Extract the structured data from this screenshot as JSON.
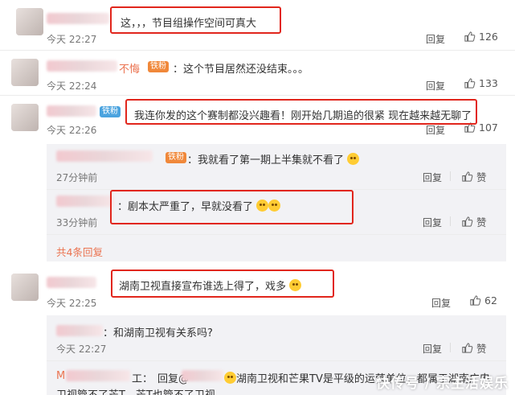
{
  "labels": {
    "reply": "回复",
    "zan": "赞"
  },
  "comments": [
    {
      "text": "这，，，节目组操作空间可真大",
      "time": "今天 22:27",
      "likes": "126"
    },
    {
      "name_suffix": "不悔",
      "badge": "铁粉",
      "text": "这个节目居然还没结束。。。",
      "time": "今天 22:24",
      "likes": "133"
    },
    {
      "badge": "铁粉",
      "text": "我连你发的这个赛制都没兴趣看！刚开始几期追的很紧 现在越来越无聊了",
      "time": "今天 22:26",
      "likes": "107"
    },
    {
      "text": "湖南卫视直接宣布谁选上得了，戏多",
      "time": "今天 22:25",
      "likes": "62"
    }
  ],
  "sub_replies_1": [
    {
      "badge": "铁粉",
      "text": "我就看了第一期上半集就不看了",
      "time": "27分钟前"
    },
    {
      "text": "剧本太严重了，早就没看了",
      "time": "33分钟前"
    }
  ],
  "more_replies": "共4条回复",
  "sub_replies_2": [
    {
      "text": "和湖南卫视有关系吗?",
      "time": "今天 22:27"
    },
    {
      "name_prefix": "M",
      "name_suffix": "工：",
      "reply_label": "回复@",
      "text": "湖南卫视和芒果TV是平级的运营单位，都属于湖南广电",
      "text2": "卫视管不了芒T，芒T也管不了卫视"
    }
  ],
  "watermark": "快传号 / 宗主活娱乐",
  "colors": {
    "highlight": "#e1261c",
    "link": "#eb7350",
    "badge": "#4aa3df",
    "subpanel": "#f2f2f5"
  }
}
